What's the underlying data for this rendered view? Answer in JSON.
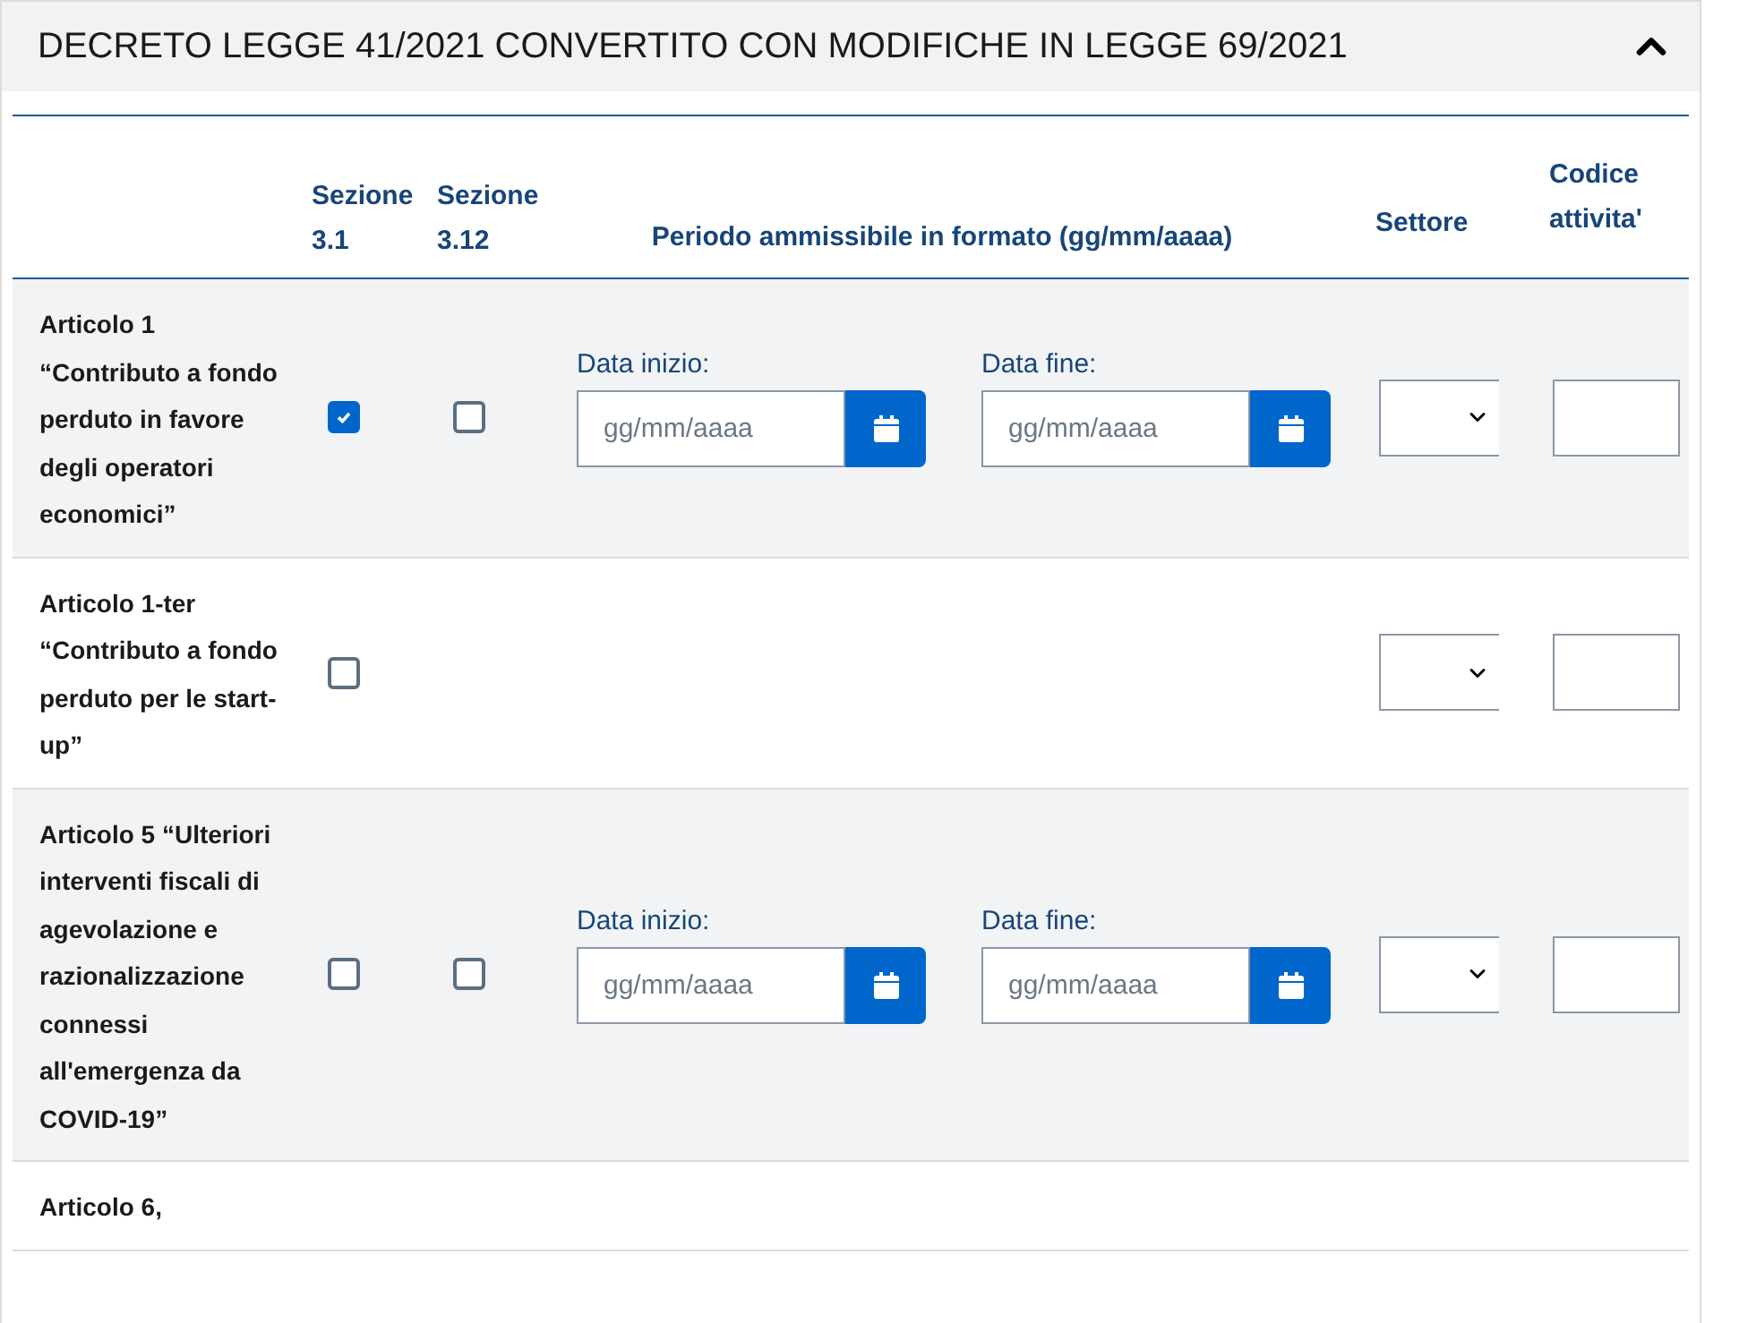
{
  "panel": {
    "title": "DECRETO LEGGE 41/2021 CONVERTITO CON MODIFICHE IN LEGGE 69/2021",
    "expanded": true
  },
  "table": {
    "columns": [
      "Sezione 3.1",
      "Sezione 3.12",
      "Periodo ammissibile in formato (gg/mm/aaaa)",
      "Settore",
      "Codice attivita'"
    ],
    "rows": [
      {
        "title": "Articolo 1 “Contributo a fondo perduto in favore degli operatori economici”",
        "sezione_3_1": {
          "checked": true
        },
        "sezione_3_12": {
          "checked": false
        },
        "start_date": {
          "label": "Data inizio:",
          "placeholder": "gg/mm/aaaa"
        },
        "end_date": {
          "label": "Data fine:",
          "placeholder": "gg/mm/aaaa"
        },
        "settore_select": true,
        "codice_field": true
      },
      {
        "title": "Articolo 1-ter “Contributo a fondo perduto per le start-up”",
        "sezione_3_1": {
          "checked": false
        },
        "settore_select": true,
        "codice_field": true
      },
      {
        "title": "Articolo 5 “Ulteriori interventi fiscali di agevolazione e razionalizzazione connessi all'emergenza da COVID-19”",
        "sezione_3_1": {
          "checked": false
        },
        "sezione_3_12": {
          "checked": false
        },
        "start_date": {
          "label": "Data inizio:",
          "placeholder": "gg/mm/aaaa"
        },
        "end_date": {
          "label": "Data fine:",
          "placeholder": "gg/mm/aaaa"
        },
        "settore_select": true,
        "codice_field": true
      },
      {
        "title": "Articolo 6,"
      }
    ]
  }
}
